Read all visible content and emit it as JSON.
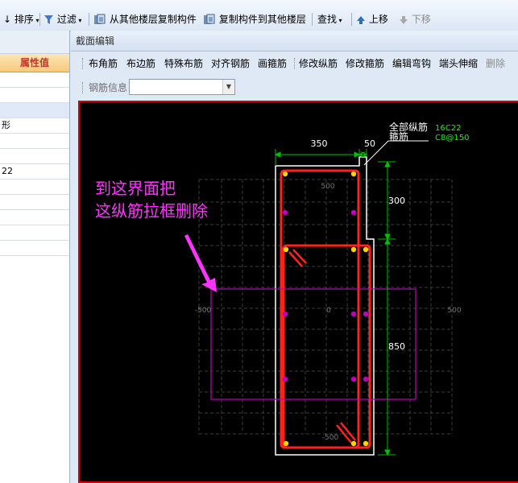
{
  "toolbar": {
    "sort_label": "排序",
    "filter_label": "过滤",
    "copy_from_floor_label": "从其他楼层复制构件",
    "copy_to_floor_label": "复制构件到其他楼层",
    "find_label": "查找",
    "move_up_label": "上移",
    "move_down_label": "下移"
  },
  "property_panel": {
    "header": "属性值",
    "rows": [
      "",
      "",
      "",
      "形",
      "",
      "",
      "22",
      "",
      "",
      "",
      "",
      ""
    ]
  },
  "editor": {
    "title": "截面编辑",
    "tools": [
      "布角筋",
      "布边筋",
      "特殊布筋",
      "对齐钢筋",
      "画箍筋",
      "修改纵筋",
      "修改箍筋",
      "编辑弯钩",
      "端头伸缩",
      "删除"
    ],
    "rebar_info_label": "钢筋信息",
    "rebar_info_value": ""
  },
  "drawing": {
    "dims": {
      "top_left": "350",
      "top_right": "50",
      "right_upper": "300",
      "right_lower": "850"
    },
    "legend": {
      "longitudinal_label": "全部纵筋",
      "longitudinal_value": "16C22",
      "stirrup_label": "箍筋",
      "stirrup_value": "C8@150"
    },
    "grid_labels": {
      "top": "500",
      "left": "-500",
      "center": "0",
      "right": "500",
      "bottom": "-500"
    },
    "annotation_line1": "到这界面把",
    "annotation_line2": "这纵筋拉框删除"
  },
  "colors": {
    "canvas": "#000000",
    "outline": "#ffffff",
    "rebar": "#ff2020",
    "bar_dot": "#ffd400",
    "bar_dot_side": "#c000c0",
    "dimension": "#00c000",
    "selection_box": "#c000c0",
    "annotation": "#ff33ff",
    "legend_value": "#00ff00",
    "header_text": "#c0392b"
  }
}
